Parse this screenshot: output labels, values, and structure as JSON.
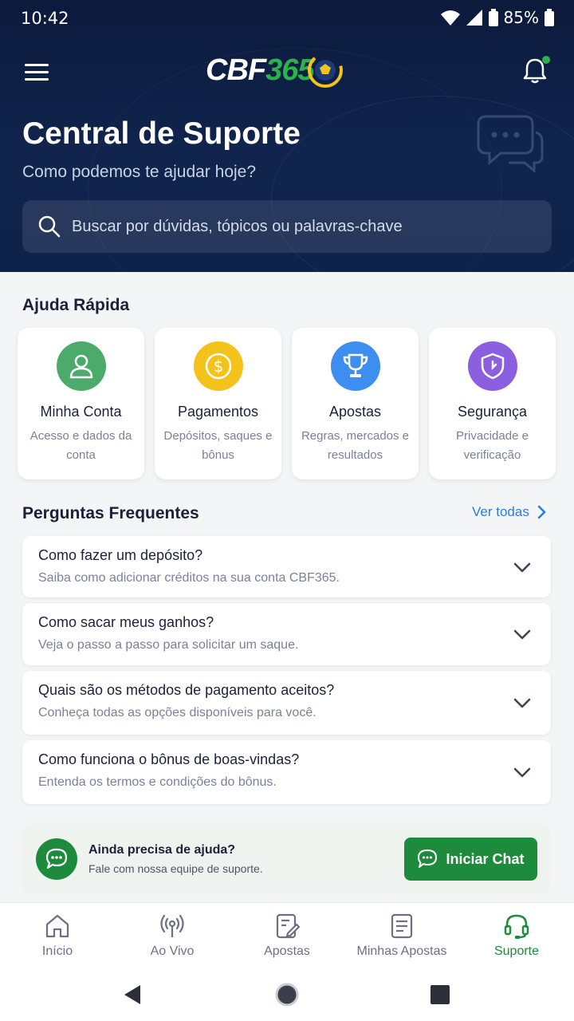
{
  "status_bar": {
    "time": "10:42",
    "battery": "85%"
  },
  "brand": {
    "logo_left": "CBF",
    "logo_right": "365"
  },
  "hero": {
    "title": "Central de Suporte",
    "subtitle": "Como podemos te ajudar hoje?",
    "search_placeholder": "Buscar por dúvidas, tópicos ou palavras-chave"
  },
  "quick_help": {
    "title": "Ajuda Rápida",
    "cards": [
      {
        "title": "Minha Conta",
        "desc": "Acesso e dados da conta",
        "icon": "user-icon",
        "color": "#4caa6a"
      },
      {
        "title": "Pagamentos",
        "desc": "Depósitos, saques e bônus",
        "icon": "dollar-coin-icon",
        "color": "#f3c21b"
      },
      {
        "title": "Apostas",
        "desc": "Regras, mercados e resultados",
        "icon": "trophy-icon",
        "color": "#3d8ef0"
      },
      {
        "title": "Segurança",
        "desc": "Privacidade e verificação",
        "icon": "shield-icon",
        "color": "#8b5fe0"
      }
    ]
  },
  "faq": {
    "title": "Perguntas Frequentes",
    "see_all": "Ver todas",
    "items": [
      {
        "q": "Como fazer um depósito?",
        "a": "Saiba como adicionar créditos na sua conta CBF365."
      },
      {
        "q": "Como sacar meus ganhos?",
        "a": "Veja o passo a passo para solicitar um saque."
      },
      {
        "q": "Quais são os métodos de pagamento aceitos?",
        "a": "Conheça todas as opções disponíveis para você."
      },
      {
        "q": "Como funciona o bônus de boas-vindas?",
        "a": "Entenda os termos e condições do bônus."
      }
    ]
  },
  "help_box": {
    "title": "Ainda precisa de ajuda?",
    "subtitle": "Fale com nossa equipe de suporte.",
    "button": "Iniciar Chat"
  },
  "bottom_nav": {
    "items": [
      {
        "label": "Início",
        "icon": "home-icon"
      },
      {
        "label": "Ao Vivo",
        "icon": "broadcast-icon"
      },
      {
        "label": "Apostas",
        "icon": "betslip-icon"
      },
      {
        "label": "Minhas Apostas",
        "icon": "document-icon"
      },
      {
        "label": "Suporte",
        "icon": "headset-icon",
        "active": true
      }
    ]
  },
  "colors": {
    "primary_green": "#1e8b3c",
    "header_navy": "#0c1a3c",
    "link_blue": "#2a7be0"
  }
}
